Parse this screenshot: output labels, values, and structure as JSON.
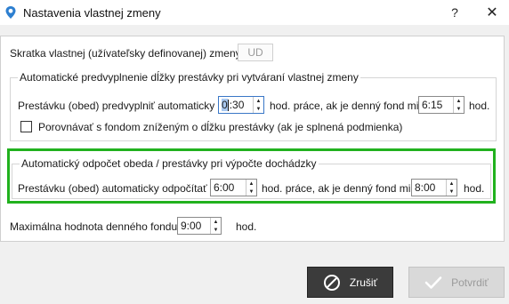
{
  "window": {
    "title": "Nastavenia vlastnej zmeny",
    "help": "?",
    "close": "✕"
  },
  "code": {
    "label": "Skratka vlastnej (užívateľsky definovanej) zmeny:",
    "value": "UD"
  },
  "auto_fill": {
    "legend": "Automatické predvyplnenie dĺžky prestávky pri vytváraní vlastnej zmeny",
    "prefix": "Prestávku (obed) predvyplniť automaticky na",
    "break_before_caret": "0",
    "break_after_caret": ":30",
    "mid": "hod. práce, ak je denný fond min.",
    "fund": "6:15",
    "suffix": "hod.",
    "compare_label": "Porovnávať s fondom zníženým o dĺžku prestávky (ak je splnená podmienka)",
    "compare_checked": false
  },
  "auto_deduct": {
    "legend": "Automatický odpočet obeda / prestávky pri výpočte dochádzky",
    "prefix": "Prestávku (obed) automaticky odpočítať po",
    "hours": "6:00",
    "mid": "hod. práce, ak je denný fond min.",
    "fund": "8:00",
    "suffix": "hod."
  },
  "max_fund": {
    "label": "Maximálna hodnota denného fondu:",
    "value": "9:00",
    "suffix": "hod."
  },
  "buttons": {
    "cancel": "Zrušiť",
    "confirm": "Potvrdiť"
  },
  "colors": {
    "highlight": "#21b11e",
    "cancel_bg": "#3b3b3b",
    "confirm_bg": "#d9d9d9"
  },
  "icons": {
    "app": "location-pin-icon",
    "cancel": "ban-icon",
    "confirm": "checkmark-icon"
  }
}
